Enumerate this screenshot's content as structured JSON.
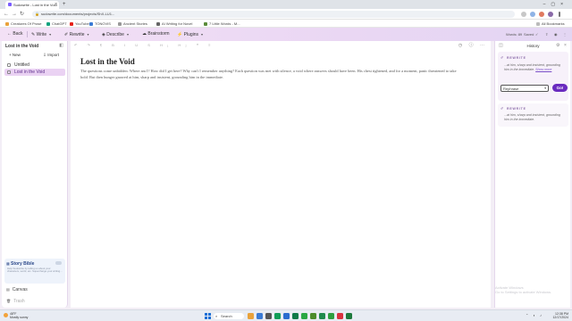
{
  "browser": {
    "tab_title": "Sudowrite - Lost in the Void",
    "url": "sudowrite.com/documents/projects/ShX-LU1...",
    "bookmarks": [
      "Creatures Of Prose",
      "ChatGPT",
      "YouTube",
      "TONOVIS",
      "Ancient Stories",
      "AI Writing for Novel",
      "7 Little Words - M...",
      "All Bookmarks"
    ]
  },
  "toolbar": {
    "back": "Back",
    "write": "Write",
    "rewrite": "Rewrite",
    "describe": "Describe",
    "brainstorm": "Brainstorm",
    "plugins": "Plugins",
    "words": "Words: 89",
    "saved": "Saved"
  },
  "sidebar": {
    "project_title": "Lost in the Void",
    "new_label": "New",
    "import_label": "Import",
    "documents": [
      {
        "label": "Untitled",
        "active": false
      },
      {
        "label": "Lost in the Void",
        "active": true
      }
    ],
    "story_bible": {
      "title": "Story Bible",
      "description": "Help Sudowrite by telling us about your characters, world, etc. Supercharge your writing..."
    },
    "canvas": "Canvas",
    "trash": "Trash"
  },
  "editor": {
    "title": "Lost in the Void",
    "body": "The questions come unbidden: Where am I? How did I get here? Why can't I remember anything? Each question was met with silence, a void where answers should have been. His chest tightened, and for a moment, panic threatened to take hold. But then hunger gnawed at him, sharp and insistent, grounding him in the immediate."
  },
  "history": {
    "title": "History",
    "card1_label": "REWRITE",
    "card1_text": "...at him, sharp and insistent, grounding him in the immediate.",
    "card1_link": "Show more",
    "select_value": "Rephrase",
    "go_label": "Go!",
    "card2_label": "REWRITE",
    "card2_text": "...at him, sharp and insistent, grounding him in the immediate.",
    "watermark_title": "Activate Windows",
    "watermark_sub": "Go to Settings to activate Windows."
  },
  "taskbar": {
    "weather_temp": "48°F",
    "weather_desc": "Mostly sunny",
    "search": "Search",
    "time": "12:38 PM",
    "date": "12/17/2024"
  },
  "colors": {
    "accent": "#6a2bbf",
    "active_doc_bg": "#ead2f3",
    "toolbar_gradient_start": "#f3e1f6",
    "story_bible_bg": "#eef3fb"
  }
}
